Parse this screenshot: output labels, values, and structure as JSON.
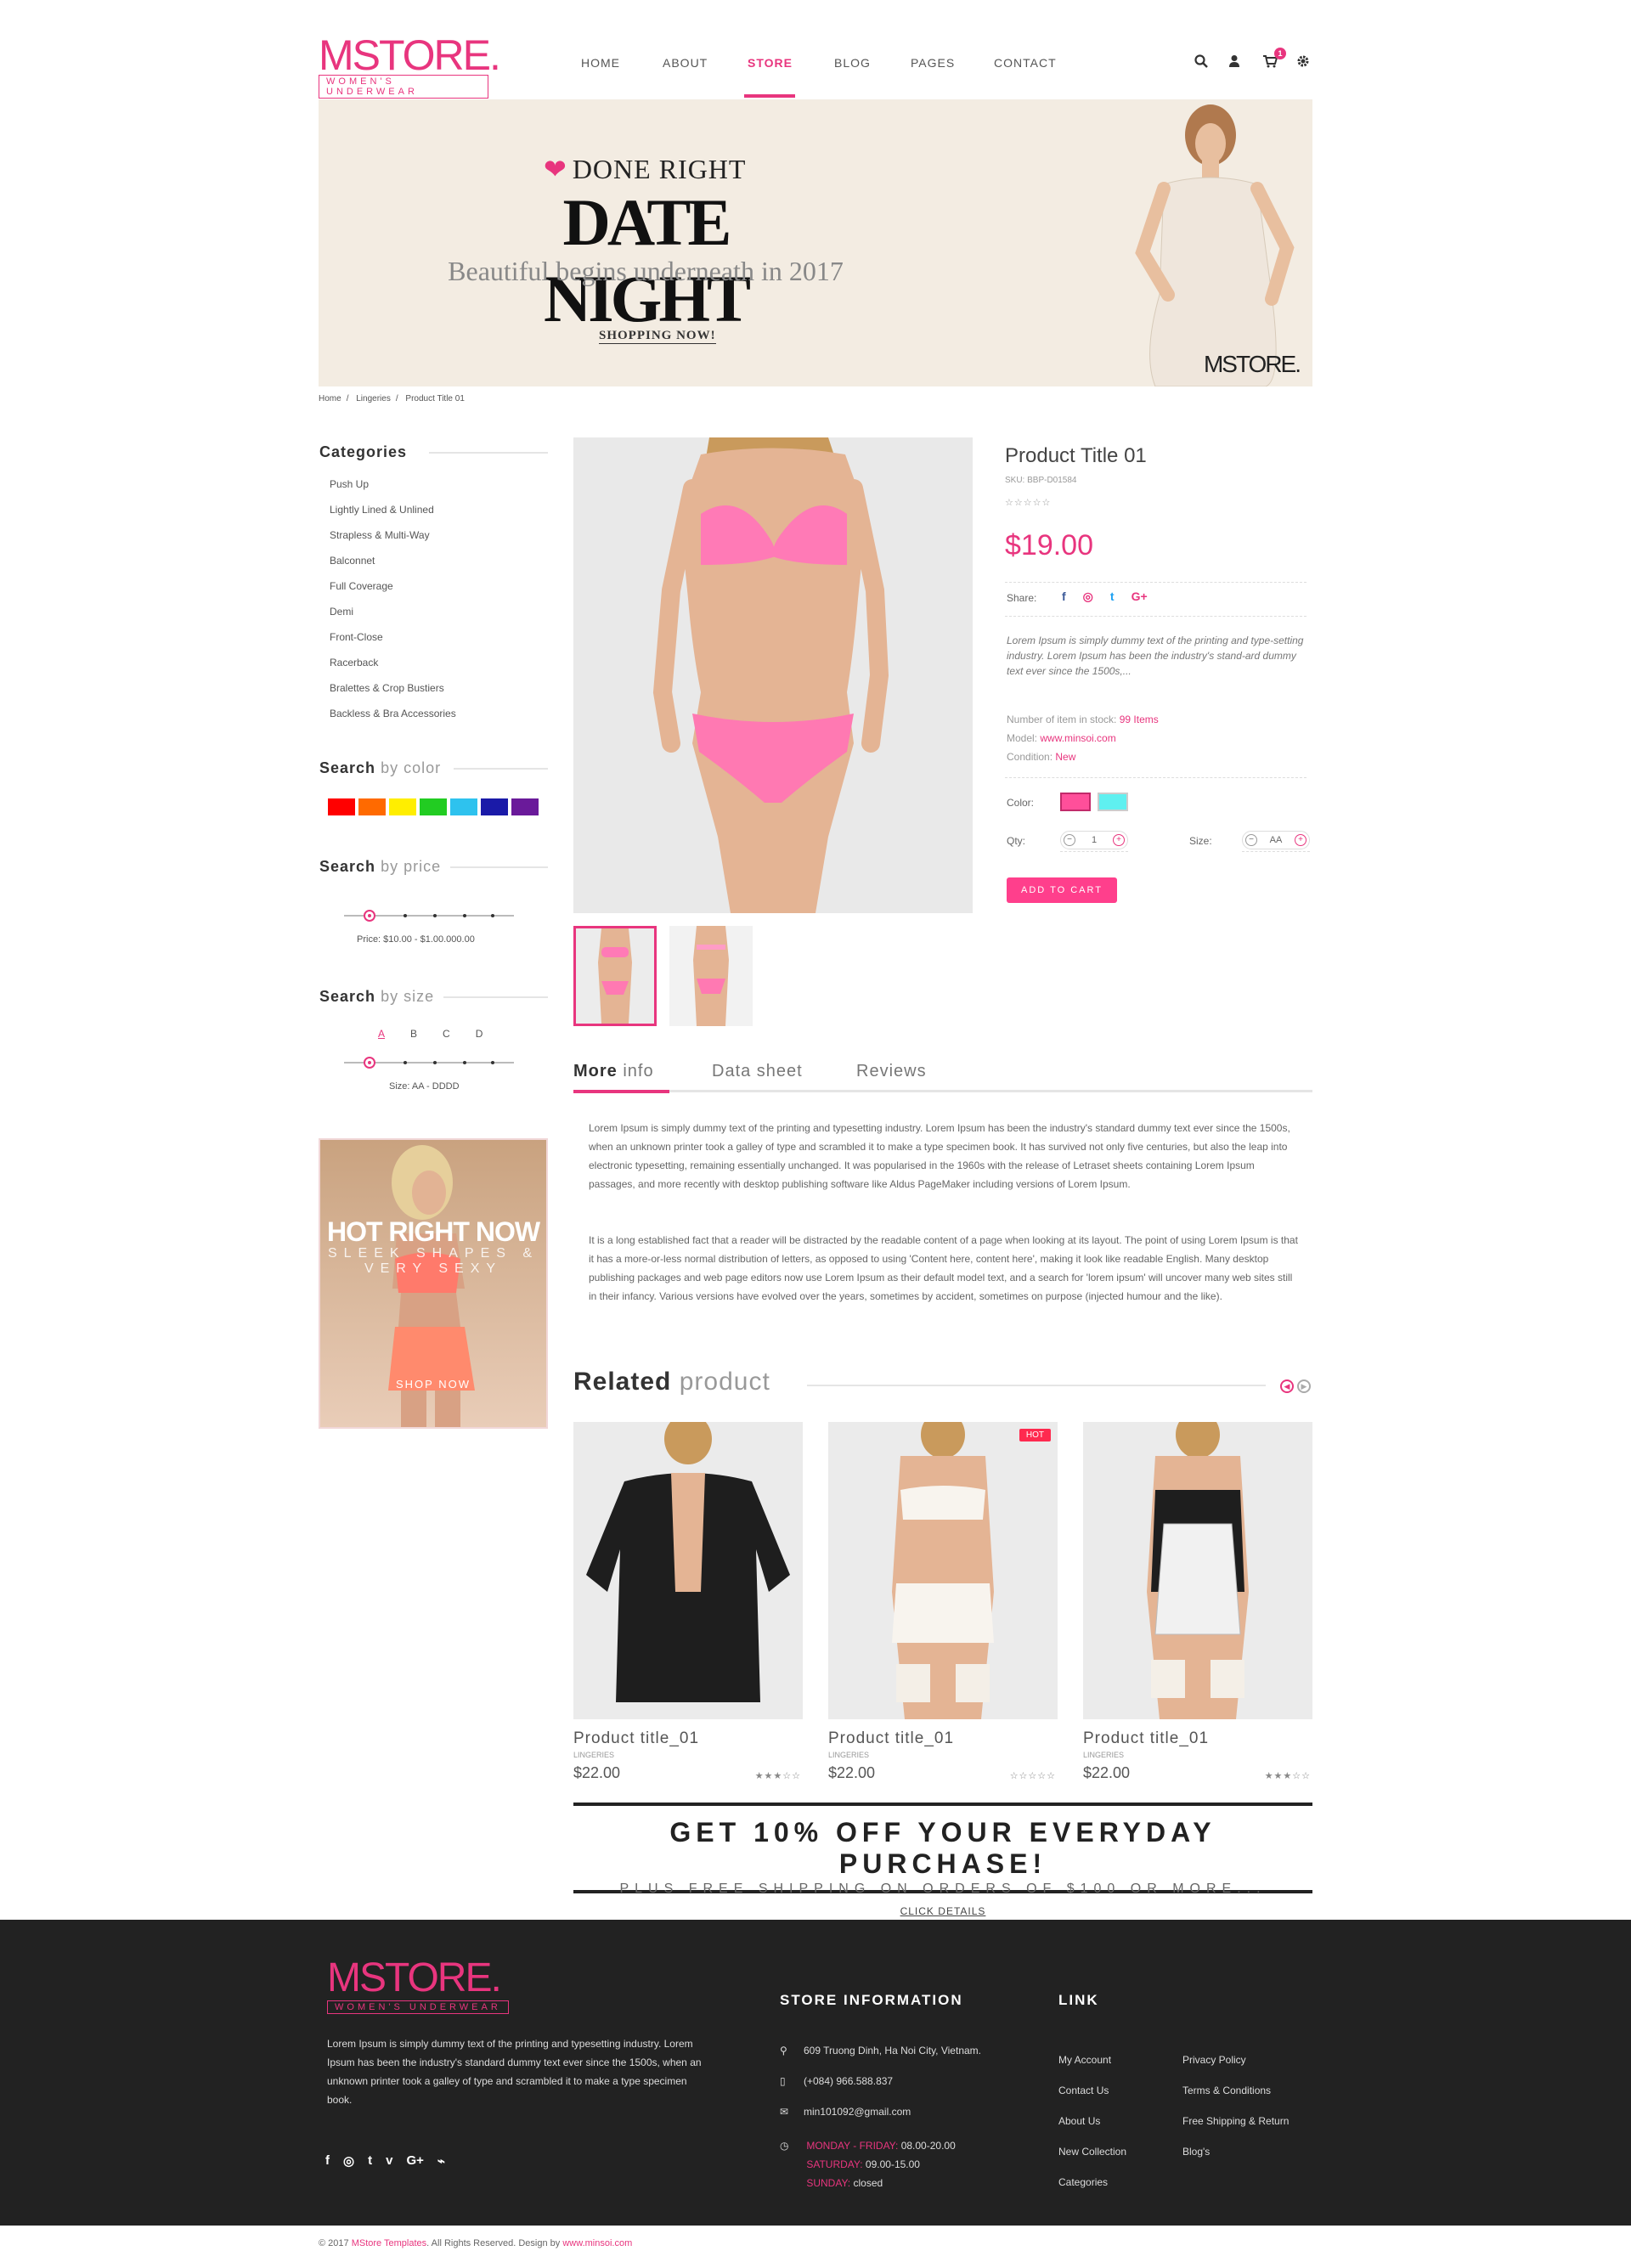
{
  "brand": {
    "name": "MSTORE.",
    "tagline": "WOMEN'S UNDERWEAR",
    "accent": "#e8357e"
  },
  "nav": [
    {
      "label": "HOME",
      "active": false
    },
    {
      "label": "ABOUT",
      "active": false
    },
    {
      "label": "STORE",
      "active": true
    },
    {
      "label": "BLOG",
      "active": false
    },
    {
      "label": "PAGES",
      "active": false
    },
    {
      "label": "CONTACT",
      "active": false
    }
  ],
  "header_icons": {
    "search": "search-icon",
    "user": "user-icon",
    "cart": "cart-icon",
    "cart_count": "1",
    "settings": "gear-icon"
  },
  "banner": {
    "kicker": "DONE RIGHT",
    "title": "DATE NIGHT",
    "subtitle": "Beautiful begins underneath in 2017",
    "button": "SHOPPING NOW!",
    "logo": "MSTORE."
  },
  "breadcrumb": [
    "Home",
    "Lingeries",
    "Product Title 01"
  ],
  "sidebar": {
    "categories_title": "Categories",
    "categories": [
      "Push Up",
      "Lightly Lined & Unlined",
      "Strapless & Multi-Way",
      "Balconnet",
      "Full Coverage",
      "Demi",
      "Front-Close",
      "Racerback",
      "Bralettes & Crop Bustiers",
      "Backless & Bra Accessories"
    ],
    "color_title": "Search",
    "color_title_em": "by color",
    "colors": [
      "#ff0000",
      "#ff6a00",
      "#ffee00",
      "#22cc22",
      "#2ec2ee",
      "#1a1aa8",
      "#6a1a9a"
    ],
    "price_title": "Search",
    "price_title_em": "by price",
    "price_range": "Price: $10.00 - $1.00.000.00",
    "size_title": "Search",
    "size_title_em": "by size",
    "sizes": [
      "A",
      "B",
      "C",
      "D"
    ],
    "size_range": "Size: AA - DDDD",
    "promo": {
      "title": "HOT RIGHT NOW",
      "subtitle": "SLEEK SHAPES & VERY SEXY",
      "button": "SHOP NOW"
    }
  },
  "product": {
    "title": "Product Title 01",
    "sku": "SKU: BBP-D01584",
    "rating": "☆☆☆☆☆",
    "price": "$19.00",
    "share_label": "Share:",
    "share_icons": [
      "f",
      "◎",
      "t",
      "G+"
    ],
    "description": "Lorem Ipsum is simply dummy text of the printing and type-setting industry. Lorem Ipsum has been the industry's stand-ard dummy text ever since the 1500s,...",
    "stock_label": "Number of item in stock:",
    "stock_value": "99 Items",
    "model_label": "Model:",
    "model_value": "www.minsoi.com",
    "condition_label": "Condition:",
    "condition_value": "New",
    "color_label": "Color:",
    "color_options": [
      "#ff4f9a",
      "#5ff0f0"
    ],
    "qty_label": "Qty:",
    "qty_value": "1",
    "size_label": "Size:",
    "size_value": "AA",
    "add_to_cart": "ADD TO CART"
  },
  "tabs": [
    {
      "label_bold": "More",
      "label": "info",
      "active": true
    },
    {
      "label_bold": "",
      "label": "Data sheet",
      "active": false
    },
    {
      "label_bold": "",
      "label": "Reviews",
      "active": false
    }
  ],
  "more_info": {
    "p1": "Lorem Ipsum is simply dummy text of the printing and typesetting industry. Lorem Ipsum has been the industry's standard dummy text ever since the 1500s, when an unknown printer took a galley of type and scrambled it to make a type specimen book. It has survived not only five centuries, but also the leap into electronic typesetting, remaining essentially unchanged. It was popularised in the 1960s with the release of Letraset sheets containing Lorem Ipsum passages, and more recently with desktop publishing software like Aldus PageMaker including versions of Lorem Ipsum.",
    "p2": "It is a long established fact that a reader will be distracted by the readable content of a page when looking at its layout. The point of using Lorem Ipsum is that it has a more-or-less normal distribution of letters, as opposed to using 'Content here, content here', making it look like readable English. Many desktop publishing packages and web page editors now use Lorem Ipsum as their default model text, and a search for 'lorem ipsum' will uncover many web sites still in their infancy. Various versions have evolved over the years, sometimes by accident, sometimes on purpose (injected humour and the like)."
  },
  "related": {
    "title": "Related",
    "title_em": "product",
    "items": [
      {
        "name": "Product title_01",
        "category": "LINGERIES",
        "price": "$22.00",
        "rating": "★★★☆☆",
        "hot": ""
      },
      {
        "name": "Product title_01",
        "category": "LINGERIES",
        "price": "$22.00",
        "rating": "☆☆☆☆☆",
        "hot": "HOT"
      },
      {
        "name": "Product title_01",
        "category": "LINGERIES",
        "price": "$22.00",
        "rating": "★★★☆☆",
        "hot": ""
      }
    ]
  },
  "offer": {
    "title": "GET 10% OFF YOUR EVERYDAY PURCHASE!",
    "subtitle": "PLUS FREE SHIPPING ON ORDERS OF $100 OR MORE...",
    "link": "CLICK DETAILS"
  },
  "footer": {
    "about": "Lorem Ipsum is simply dummy text of the printing and typesetting industry. Lorem Ipsum has been the industry's standard dummy text ever since the 1500s, when an unknown printer took a galley of type and scrambled it to make a type specimen book.",
    "social": [
      "f",
      "◎",
      "t",
      "v",
      "G+",
      "rss"
    ],
    "store_title": "STORE INFORMATION",
    "address": "609 Truong Dinh, Ha Noi City, Vietnam.",
    "phone": "(+084) 966.588.837",
    "email": "min101092@gmail.com",
    "hours1_label": "MONDAY - FRIDAY:",
    "hours1": "08.00-20.00",
    "hours2_label": "SATURDAY:",
    "hours2": "09.00-15.00",
    "hours3_label": "SUNDAY:",
    "hours3": "closed",
    "link_title": "LINK",
    "links_col1": [
      "My Account",
      "Contact Us",
      "About Us",
      "New Collection",
      "Categories"
    ],
    "links_col2": [
      "Privacy Policy",
      "Terms & Conditions",
      "Free Shipping & Return",
      "Blog's"
    ],
    "copyright": "© 2017",
    "copyright_brand": "MStore Templates",
    "copyright_rest": ". All Rights Reserved. Design by",
    "copyright_site": "www.minsoi.com"
  }
}
